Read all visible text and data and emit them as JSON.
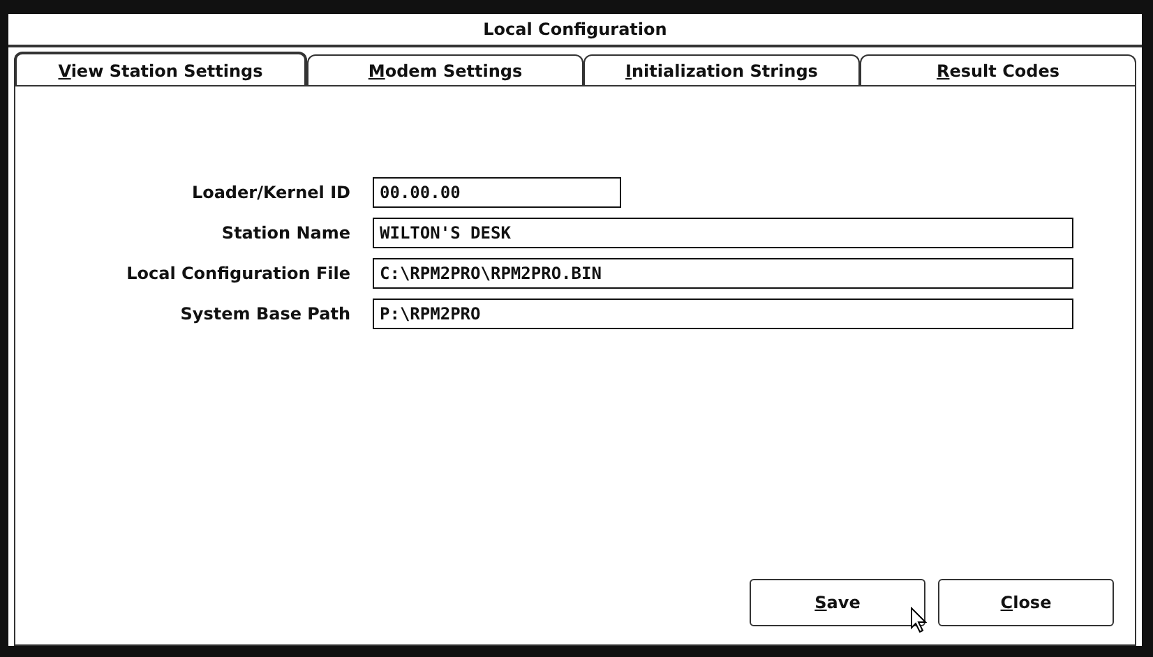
{
  "window": {
    "title": "Local Configuration"
  },
  "tabs": [
    {
      "label": "View Station Settings",
      "selected": true
    },
    {
      "label": "Modem Settings",
      "selected": false
    },
    {
      "label": "Initialization Strings",
      "selected": false
    },
    {
      "label": "Result Codes",
      "selected": false
    }
  ],
  "fields": [
    {
      "label": "Loader/Kernel ID",
      "value": "00.00.00",
      "kind": "short"
    },
    {
      "label": "Station Name",
      "value": "WILTON'S DESK",
      "kind": "long"
    },
    {
      "label": "Local Configuration File",
      "value": "C:\\RPM2PRO\\RPM2PRO.BIN",
      "kind": "long"
    },
    {
      "label": "System Base Path",
      "value": "P:\\RPM2PRO",
      "kind": "long"
    }
  ],
  "buttons": [
    "Save",
    "Close"
  ]
}
